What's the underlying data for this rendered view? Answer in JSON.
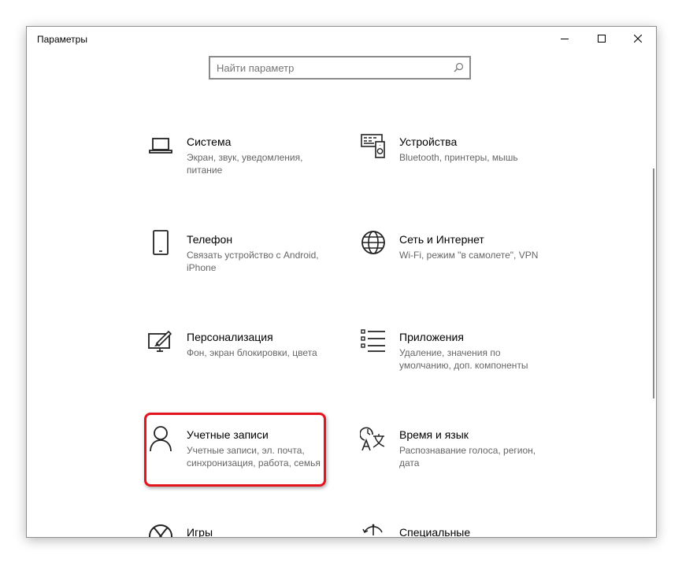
{
  "window": {
    "title": "Параметры"
  },
  "search": {
    "placeholder": "Найти параметр"
  },
  "tiles": [
    {
      "title": "Система",
      "description": "Экран, звук, уведомления, питание",
      "icon": "laptop-icon"
    },
    {
      "title": "Устройства",
      "description": "Bluetooth, принтеры, мышь",
      "icon": "devices-icon"
    },
    {
      "title": "Телефон",
      "description": "Связать устройство с Android, iPhone",
      "icon": "phone-icon"
    },
    {
      "title": "Сеть и Интернет",
      "description": "Wi-Fi, режим \"в самолете\", VPN",
      "icon": "globe-icon"
    },
    {
      "title": "Персонализация",
      "description": "Фон, экран блокировки, цвета",
      "icon": "personalization-icon"
    },
    {
      "title": "Приложения",
      "description": "Удаление, значения по умолчанию, доп. компоненты",
      "icon": "apps-list-icon"
    },
    {
      "title": "Учетные записи",
      "description": "Учетные записи, эл. почта, синхронизация, работа, семья",
      "icon": "user-account-icon"
    },
    {
      "title": "Время и язык",
      "description": "Распознавание голоса, регион, дата",
      "icon": "time-language-icon"
    },
    {
      "title": "Игры",
      "description": "",
      "icon": "xbox-icon"
    },
    {
      "title": "Специальные",
      "description": "",
      "icon": "accessibility-icon"
    }
  ],
  "highlight_color": "#e3141e"
}
